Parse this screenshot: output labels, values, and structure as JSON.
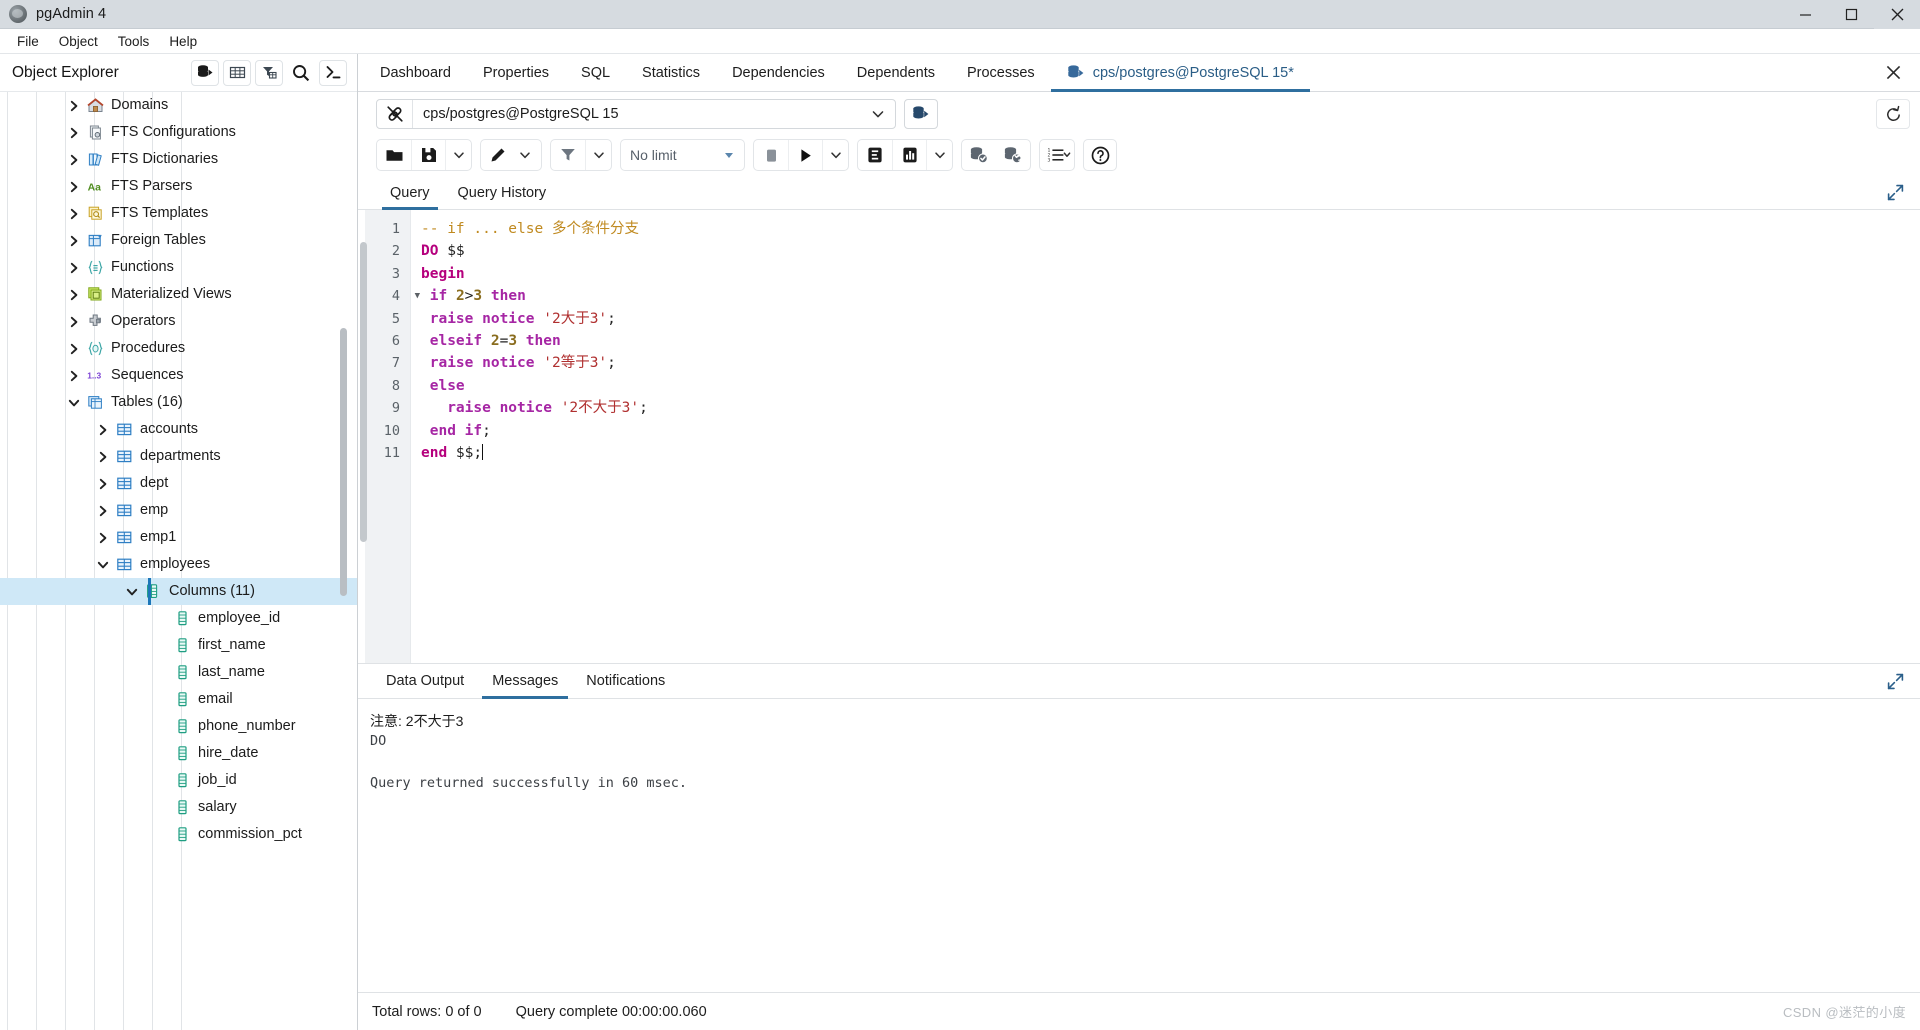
{
  "window": {
    "title": "pgAdmin 4",
    "app_icon": "pgadmin-logo-icon",
    "controls": {
      "minimize": "minimize-icon",
      "maximize": "maximize-icon",
      "close": "close-icon"
    }
  },
  "menubar": {
    "items": [
      "File",
      "Object",
      "Tools",
      "Help"
    ]
  },
  "object_explorer": {
    "title": "Object Explorer",
    "tools": [
      {
        "name": "browser-icon",
        "title": "Object Explorer toggle"
      },
      {
        "name": "grid-icon",
        "title": "Grid"
      },
      {
        "name": "filter-table-icon",
        "title": "Filter"
      },
      {
        "name": "search-icon",
        "title": "Search objects"
      },
      {
        "name": "terminal-icon",
        "title": "PSQL Tool"
      }
    ],
    "tree": [
      {
        "label": "Domains",
        "icon": "domain-icon",
        "depth": 3,
        "state": "collapsed",
        "selected": false
      },
      {
        "label": "FTS Configurations",
        "icon": "fts-configuration-icon",
        "depth": 3,
        "state": "collapsed",
        "selected": false
      },
      {
        "label": "FTS Dictionaries",
        "icon": "fts-dictionary-icon",
        "depth": 3,
        "state": "collapsed",
        "selected": false
      },
      {
        "label": "FTS Parsers",
        "icon": "fts-parser-icon",
        "depth": 3,
        "state": "collapsed",
        "selected": false
      },
      {
        "label": "FTS Templates",
        "icon": "fts-template-icon",
        "depth": 3,
        "state": "collapsed",
        "selected": false
      },
      {
        "label": "Foreign Tables",
        "icon": "foreign-table-icon",
        "depth": 3,
        "state": "collapsed",
        "selected": false
      },
      {
        "label": "Functions",
        "icon": "function-icon",
        "depth": 3,
        "state": "collapsed",
        "selected": false
      },
      {
        "label": "Materialized Views",
        "icon": "materialized-view-icon",
        "depth": 3,
        "state": "collapsed",
        "selected": false
      },
      {
        "label": "Operators",
        "icon": "operator-icon",
        "depth": 3,
        "state": "collapsed",
        "selected": false
      },
      {
        "label": "Procedures",
        "icon": "procedure-icon",
        "depth": 3,
        "state": "collapsed",
        "selected": false
      },
      {
        "label": "Sequences",
        "icon": "sequence-icon",
        "depth": 3,
        "state": "collapsed",
        "selected": false
      },
      {
        "label": "Tables (16)",
        "icon": "tables-icon",
        "depth": 3,
        "state": "expanded",
        "selected": false
      },
      {
        "label": "accounts",
        "icon": "table-icon",
        "depth": 4,
        "state": "collapsed",
        "selected": false
      },
      {
        "label": "departments",
        "icon": "table-icon",
        "depth": 4,
        "state": "collapsed",
        "selected": false
      },
      {
        "label": "dept",
        "icon": "table-icon",
        "depth": 4,
        "state": "collapsed",
        "selected": false
      },
      {
        "label": "emp",
        "icon": "table-icon",
        "depth": 4,
        "state": "collapsed",
        "selected": false
      },
      {
        "label": "emp1",
        "icon": "table-icon",
        "depth": 4,
        "state": "collapsed",
        "selected": false
      },
      {
        "label": "employees",
        "icon": "table-icon",
        "depth": 4,
        "state": "expanded",
        "selected": false
      },
      {
        "label": "Columns (11)",
        "icon": "columns-icon",
        "depth": 5,
        "state": "expanded",
        "selected": true
      },
      {
        "label": "employee_id",
        "icon": "column-icon",
        "depth": 6,
        "state": "leaf",
        "selected": false
      },
      {
        "label": "first_name",
        "icon": "column-icon",
        "depth": 6,
        "state": "leaf",
        "selected": false
      },
      {
        "label": "last_name",
        "icon": "column-icon",
        "depth": 6,
        "state": "leaf",
        "selected": false
      },
      {
        "label": "email",
        "icon": "column-icon",
        "depth": 6,
        "state": "leaf",
        "selected": false
      },
      {
        "label": "phone_number",
        "icon": "column-icon",
        "depth": 6,
        "state": "leaf",
        "selected": false
      },
      {
        "label": "hire_date",
        "icon": "column-icon",
        "depth": 6,
        "state": "leaf",
        "selected": false
      },
      {
        "label": "job_id",
        "icon": "column-icon",
        "depth": 6,
        "state": "leaf",
        "selected": false
      },
      {
        "label": "salary",
        "icon": "column-icon",
        "depth": 6,
        "state": "leaf",
        "selected": false
      },
      {
        "label": "commission_pct",
        "icon": "column-icon",
        "depth": 6,
        "state": "leaf",
        "selected": false
      }
    ]
  },
  "main_tabs": {
    "items": [
      {
        "label": "Dashboard",
        "active": false,
        "icon": null
      },
      {
        "label": "Properties",
        "active": false,
        "icon": null
      },
      {
        "label": "SQL",
        "active": false,
        "icon": null
      },
      {
        "label": "Statistics",
        "active": false,
        "icon": null
      },
      {
        "label": "Dependencies",
        "active": false,
        "icon": null
      },
      {
        "label": "Dependents",
        "active": false,
        "icon": null
      },
      {
        "label": "Processes",
        "active": false,
        "icon": null
      },
      {
        "label": "cps/postgres@PostgreSQL 15*",
        "active": true,
        "icon": "query-tool-icon"
      }
    ],
    "close_icon": "close-icon"
  },
  "connection_bar": {
    "icon": "connection-icon",
    "value": "cps/postgres@PostgreSQL 15",
    "caret_icon": "chevron-down-icon",
    "manage_icon": "server-manage-icon",
    "reset_icon": "reset-layout-icon"
  },
  "query_toolbar": {
    "buttons": [
      {
        "name": "open-file-icon",
        "group": 0,
        "kind": "icon"
      },
      {
        "name": "save-file-icon",
        "group": 0,
        "kind": "icon"
      },
      {
        "name": "save-dropdown-caret-icon",
        "group": 0,
        "kind": "caret"
      },
      {
        "name": "edit-pencil-icon",
        "group": 1,
        "kind": "icon"
      },
      {
        "name": "edit-dropdown-caret-icon",
        "group": 1,
        "kind": "caret"
      },
      {
        "name": "filter-icon",
        "group": 2,
        "kind": "icon"
      },
      {
        "name": "filter-dropdown-caret-icon",
        "group": 2,
        "kind": "caret"
      },
      {
        "name": "stop-icon",
        "group": 3,
        "kind": "icon"
      },
      {
        "name": "execute-play-icon",
        "group": 3,
        "kind": "icon"
      },
      {
        "name": "execute-dropdown-caret-icon",
        "group": 3,
        "kind": "caret"
      },
      {
        "name": "explain-icon",
        "group": 4,
        "kind": "icon"
      },
      {
        "name": "explain-analyze-icon",
        "group": 4,
        "kind": "icon"
      },
      {
        "name": "explain-dropdown-caret-icon",
        "group": 4,
        "kind": "caret"
      },
      {
        "name": "commit-icon",
        "group": 5,
        "kind": "icon"
      },
      {
        "name": "rollback-icon",
        "group": 5,
        "kind": "icon"
      },
      {
        "name": "macros-icon",
        "group": 6,
        "kind": "icon"
      },
      {
        "name": "macros-dropdown-caret-icon",
        "group": 6,
        "kind": "caret"
      },
      {
        "name": "help-icon",
        "group": 7,
        "kind": "icon"
      }
    ],
    "limit": {
      "label": "No limit",
      "caret_icon": "chevron-down-icon"
    }
  },
  "query_tabs": {
    "items": [
      {
        "label": "Query",
        "active": true
      },
      {
        "label": "Query History",
        "active": false
      }
    ],
    "expand_icon": "expand-panel-icon"
  },
  "editor": {
    "line_numbers": [
      "1",
      "2",
      "3",
      "4",
      "5",
      "6",
      "7",
      "8",
      "9",
      "10",
      "11"
    ],
    "fold_marker_line": 4,
    "fold_icon": "fold-triangle-icon",
    "lines": [
      {
        "n": 1,
        "tokens": [
          {
            "t": "-- if ... else 多个条件分支",
            "c": "c"
          }
        ]
      },
      {
        "n": 2,
        "tokens": [
          {
            "t": "DO",
            "c": "kb"
          },
          {
            "t": " $$",
            "c": "p"
          }
        ]
      },
      {
        "n": 3,
        "tokens": [
          {
            "t": "begin",
            "c": "kb"
          }
        ]
      },
      {
        "n": 4,
        "tokens": [
          {
            "t": " ",
            "c": "p"
          },
          {
            "t": "if",
            "c": "k"
          },
          {
            "t": " ",
            "c": "p"
          },
          {
            "t": "2",
            "c": "n"
          },
          {
            "t": ">",
            "c": "p"
          },
          {
            "t": "3",
            "c": "n"
          },
          {
            "t": " ",
            "c": "p"
          },
          {
            "t": "then",
            "c": "k"
          }
        ]
      },
      {
        "n": 5,
        "tokens": [
          {
            "t": " ",
            "c": "p"
          },
          {
            "t": "raise notice",
            "c": "k"
          },
          {
            "t": " ",
            "c": "p"
          },
          {
            "t": "'2大于3'",
            "c": "s"
          },
          {
            "t": ";",
            "c": "p"
          }
        ]
      },
      {
        "n": 6,
        "tokens": [
          {
            "t": " ",
            "c": "p"
          },
          {
            "t": "elseif",
            "c": "k"
          },
          {
            "t": " ",
            "c": "p"
          },
          {
            "t": "2",
            "c": "n"
          },
          {
            "t": "=",
            "c": "p"
          },
          {
            "t": "3",
            "c": "n"
          },
          {
            "t": " ",
            "c": "p"
          },
          {
            "t": "then",
            "c": "k"
          }
        ]
      },
      {
        "n": 7,
        "tokens": [
          {
            "t": " ",
            "c": "p"
          },
          {
            "t": "raise notice",
            "c": "k"
          },
          {
            "t": " ",
            "c": "p"
          },
          {
            "t": "'2等于3'",
            "c": "s"
          },
          {
            "t": ";",
            "c": "p"
          }
        ]
      },
      {
        "n": 8,
        "tokens": [
          {
            "t": " ",
            "c": "p"
          },
          {
            "t": "else",
            "c": "k"
          }
        ]
      },
      {
        "n": 9,
        "tokens": [
          {
            "t": "   ",
            "c": "p"
          },
          {
            "t": "raise notice",
            "c": "k"
          },
          {
            "t": " ",
            "c": "p"
          },
          {
            "t": "'2不大于3'",
            "c": "s"
          },
          {
            "t": ";",
            "c": "p"
          }
        ]
      },
      {
        "n": 10,
        "tokens": [
          {
            "t": " ",
            "c": "p"
          },
          {
            "t": "end if",
            "c": "k"
          },
          {
            "t": ";",
            "c": "p"
          }
        ]
      },
      {
        "n": 11,
        "tokens": [
          {
            "t": "end",
            "c": "kb"
          },
          {
            "t": " $$;",
            "c": "p"
          }
        ]
      }
    ]
  },
  "output_tabs": {
    "items": [
      {
        "label": "Data Output",
        "active": false
      },
      {
        "label": "Messages",
        "active": true
      },
      {
        "label": "Notifications",
        "active": false
      }
    ],
    "expand_icon": "expand-panel-icon"
  },
  "messages": {
    "lines": [
      {
        "text": "注意:  2不大于3",
        "mono": false
      },
      {
        "text": "DO",
        "mono": true
      },
      {
        "text": "",
        "mono": true
      },
      {
        "text": "Query returned successfully in 60 msec.",
        "mono": true
      }
    ]
  },
  "statusbar": {
    "total_rows": "Total rows: 0 of 0",
    "query_complete": "Query complete 00:00:00.060",
    "watermark": "CSDN @迷茫的小度"
  },
  "colors": {
    "accent": "#2f6f9f",
    "selection": "#cfe8f7",
    "titlebar": "#d6dbe0",
    "gutter": "#f0f2f4",
    "keyword": "#a626a4",
    "string": "#b03030",
    "comment": "#c08a20",
    "number": "#8a6d1f"
  }
}
